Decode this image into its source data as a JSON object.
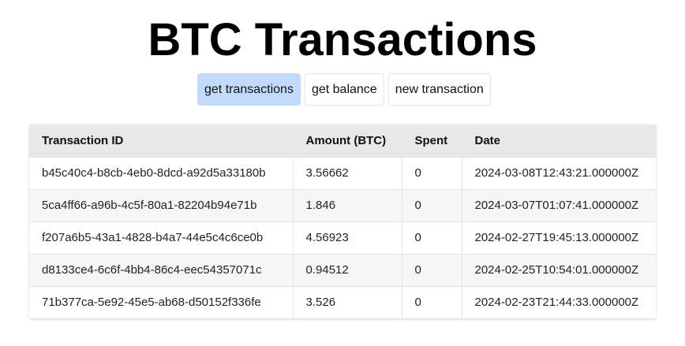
{
  "page": {
    "title": "BTC Transactions"
  },
  "buttons": [
    {
      "label": "get transactions",
      "active": true
    },
    {
      "label": "get balance",
      "active": false
    },
    {
      "label": "new transaction",
      "active": false
    }
  ],
  "colors": {
    "active_button_bg": "#c3dbfb",
    "header_bg": "#e8e8ea",
    "striped_row_bg": "#f6f6f8"
  },
  "table": {
    "headers": [
      "Transaction ID",
      "Amount (BTC)",
      "Spent",
      "Date"
    ],
    "rows": [
      [
        "b45c40c4-b8cb-4eb0-8dcd-a92d5a33180b",
        "3.56662",
        "0",
        "2024-03-08T12:43:21.000000Z"
      ],
      [
        "5ca4ff66-a96b-4c5f-80a1-82204b94e71b",
        "1.846",
        "0",
        "2024-03-07T01:07:41.000000Z"
      ],
      [
        "f207a6b5-43a1-4828-b4a7-44e5c4c6ce0b",
        "4.56923",
        "0",
        "2024-02-27T19:45:13.000000Z"
      ],
      [
        "d8133ce4-6c6f-4bb4-86c4-eec54357071c",
        "0.94512",
        "0",
        "2024-02-25T10:54:01.000000Z"
      ],
      [
        "71b377ca-5e92-45e5-ab68-d50152f336fe",
        "3.526",
        "0",
        "2024-02-23T21:44:33.000000Z"
      ]
    ]
  }
}
